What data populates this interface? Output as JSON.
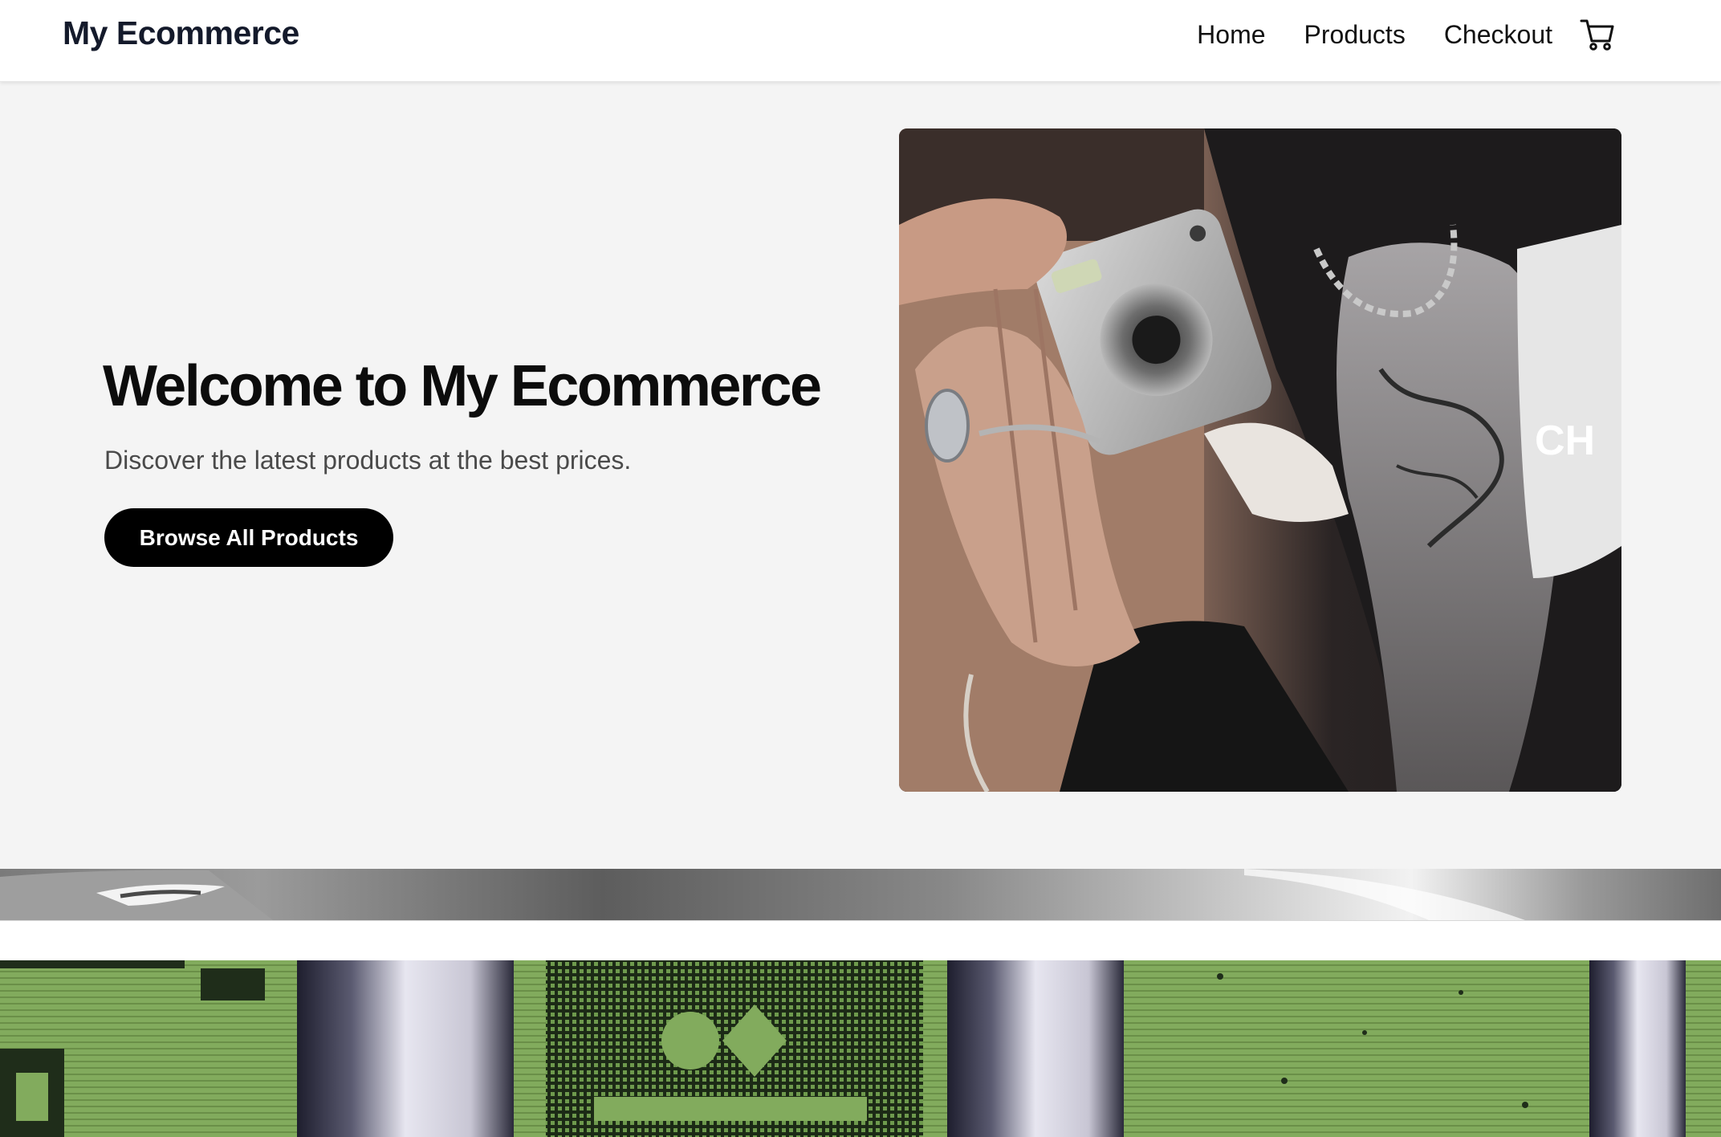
{
  "nav": {
    "brand": "My Ecommerce",
    "links": [
      "Home",
      "Products",
      "Checkout"
    ],
    "cart_icon": "shopping-cart-icon"
  },
  "hero": {
    "title": "Welcome to My Ecommerce",
    "subtitle": "Discover the latest products at the best prices.",
    "cta_label": "Browse All Products",
    "image_overlay_text": "CH",
    "image_alt": "Two people holding a compact camera"
  },
  "colors": {
    "nav_background": "#ffffff",
    "brand_text": "#141a2b",
    "hero_background": "#f4f4f4",
    "cta_background": "#000000",
    "cta_text": "#ffffff",
    "subtitle_text": "#4a4a4a",
    "green_banner": "#7da35a"
  }
}
